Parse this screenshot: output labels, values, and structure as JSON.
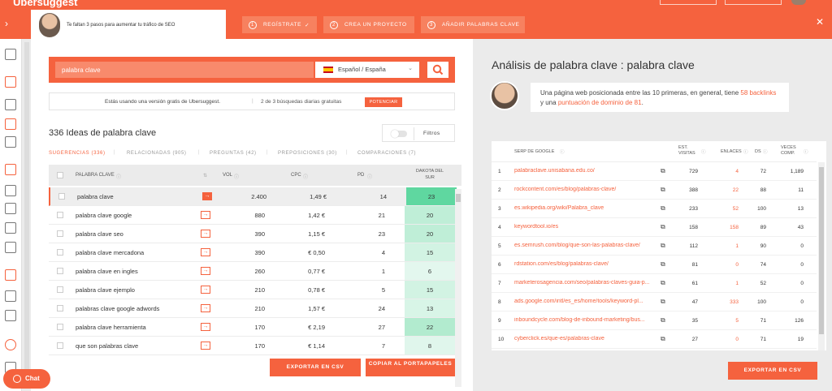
{
  "brand": {
    "name": "Ubersuggest",
    "accent": "#f5623e"
  },
  "progress": {
    "tip_text": "Te faltan 3 pasos para aumentar tu tráfico de SEO",
    "steps": [
      {
        "num": "1",
        "label": "REGÍSTRATE",
        "check": "✓"
      },
      {
        "num": "2",
        "label": "CREA UN PROYECTO"
      },
      {
        "num": "3",
        "label": "AÑADIR PALABRAS CLAVE"
      }
    ]
  },
  "search": {
    "keyword": "palabra clave",
    "language": "Español / España"
  },
  "free_bar": {
    "message": "Estás usando una versión gratis de Ubersuggest.",
    "searches": "2 de 3 búsquedas diarias gratuitas",
    "upgrade_label": "POTENCIAR"
  },
  "ideas": {
    "title": "336 Ideas de palabra clave",
    "filters_label": "Filtros",
    "tabs": [
      {
        "label": "SUGERENCIAS (336)",
        "active": true
      },
      {
        "label": "RELACIONADAS (905)"
      },
      {
        "label": "PREGUNTAS (42)"
      },
      {
        "label": "PREPOSICIONES (30)"
      },
      {
        "label": "COMPARACIONES (7)"
      }
    ],
    "columns": {
      "keyword": "PALABRA CLAVE",
      "vol": "VOL",
      "cpc": "CPC",
      "pd": "PD",
      "ds": "DAKOTA DEL SUR"
    },
    "rows": [
      {
        "keyword": "palabra clave",
        "vol": "2.400",
        "cpc": "1,49 €",
        "pd": "14",
        "ds": "23",
        "ds_color": "#5fd7a0",
        "selected": true
      },
      {
        "keyword": "palabra clave google",
        "vol": "880",
        "cpc": "1,42 €",
        "pd": "21",
        "ds": "20",
        "ds_color": "#bfeed7"
      },
      {
        "keyword": "palabra clave seo",
        "vol": "390",
        "cpc": "1,15 €",
        "pd": "23",
        "ds": "20",
        "ds_color": "#bfeed7"
      },
      {
        "keyword": "palabra clave mercadona",
        "vol": "390",
        "cpc": "€ 0,50",
        "pd": "4",
        "ds": "15",
        "ds_color": "#d2f3e3"
      },
      {
        "keyword": "palabra clave en ingles",
        "vol": "260",
        "cpc": "0,77 €",
        "pd": "1",
        "ds": "6",
        "ds_color": "#e3f7ee"
      },
      {
        "keyword": "palabra clave ejemplo",
        "vol": "210",
        "cpc": "0,78 €",
        "pd": "5",
        "ds": "15",
        "ds_color": "#d2f3e3"
      },
      {
        "keyword": "palabras clave google adwords",
        "vol": "210",
        "cpc": "1,57 €",
        "pd": "24",
        "ds": "13",
        "ds_color": "#d8f5e7"
      },
      {
        "keyword": "palabra clave herramienta",
        "vol": "170",
        "cpc": "€ 2,19",
        "pd": "27",
        "ds": "22",
        "ds_color": "#b2ebcf"
      },
      {
        "keyword": "que son palabras clave",
        "vol": "170",
        "cpc": "€ 1,14",
        "pd": "7",
        "ds": "8",
        "ds_color": "#e0f6ec"
      }
    ],
    "export_label": "EXPORTAR EN CSV",
    "copy_label": "COPIAR AL PORTAPAPELES"
  },
  "analysis": {
    "title": "Análisis de palabra clave : palabra clave",
    "summary_before": "Una página web posicionada entre las 10 primeras, en general, tiene",
    "summary_backlinks": "58 backlinks",
    "summary_middle": "y una",
    "summary_ds": "puntuación de dominio de 81",
    "summary_end": ".",
    "columns": {
      "serp": "SERP DE GOOGLE",
      "visits": "EST. VISITAS",
      "links": "ENLACES",
      "ds": "DS",
      "shares": "VECES COMP."
    },
    "rows": [
      {
        "pos": "1",
        "url": "palabraclave.unisabana.edu.co/",
        "visits": "729",
        "links": "4",
        "ds": "72",
        "shares": "1,189"
      },
      {
        "pos": "2",
        "url": "rockcontent.com/es/blog/palabras-clave/",
        "visits": "388",
        "links": "22",
        "ds": "88",
        "shares": "11"
      },
      {
        "pos": "3",
        "url": "es.wikipedia.org/wiki/Palabra_clave",
        "visits": "233",
        "links": "52",
        "ds": "100",
        "shares": "13"
      },
      {
        "pos": "4",
        "url": "keywordtool.io/es",
        "visits": "158",
        "links": "158",
        "ds": "89",
        "shares": "43"
      },
      {
        "pos": "5",
        "url": "es.semrush.com/blog/que-son-las-palabras-clave/",
        "visits": "112",
        "links": "1",
        "ds": "90",
        "shares": "0"
      },
      {
        "pos": "6",
        "url": "rdstation.com/es/blog/palabras-clave/",
        "visits": "81",
        "links": "0",
        "ds": "74",
        "shares": "0"
      },
      {
        "pos": "7",
        "url": "marketerosagencia.com/seo/palabras-claves-guia-p...",
        "visits": "61",
        "links": "1",
        "ds": "52",
        "shares": "0"
      },
      {
        "pos": "8",
        "url": "ads.google.com/intl/es_es/home/tools/keyword-pl...",
        "visits": "47",
        "links": "333",
        "ds": "100",
        "shares": "0"
      },
      {
        "pos": "9",
        "url": "inboundcycle.com/blog-de-inbound-marketing/bus...",
        "visits": "35",
        "links": "5",
        "ds": "71",
        "shares": "126"
      },
      {
        "pos": "10",
        "url": "cyberclick.es/que-es/palabras-clave",
        "visits": "27",
        "links": "0",
        "ds": "71",
        "shares": "19"
      }
    ],
    "export_label": "EXPORTAR EN CSV"
  },
  "chat_label": "Chat"
}
